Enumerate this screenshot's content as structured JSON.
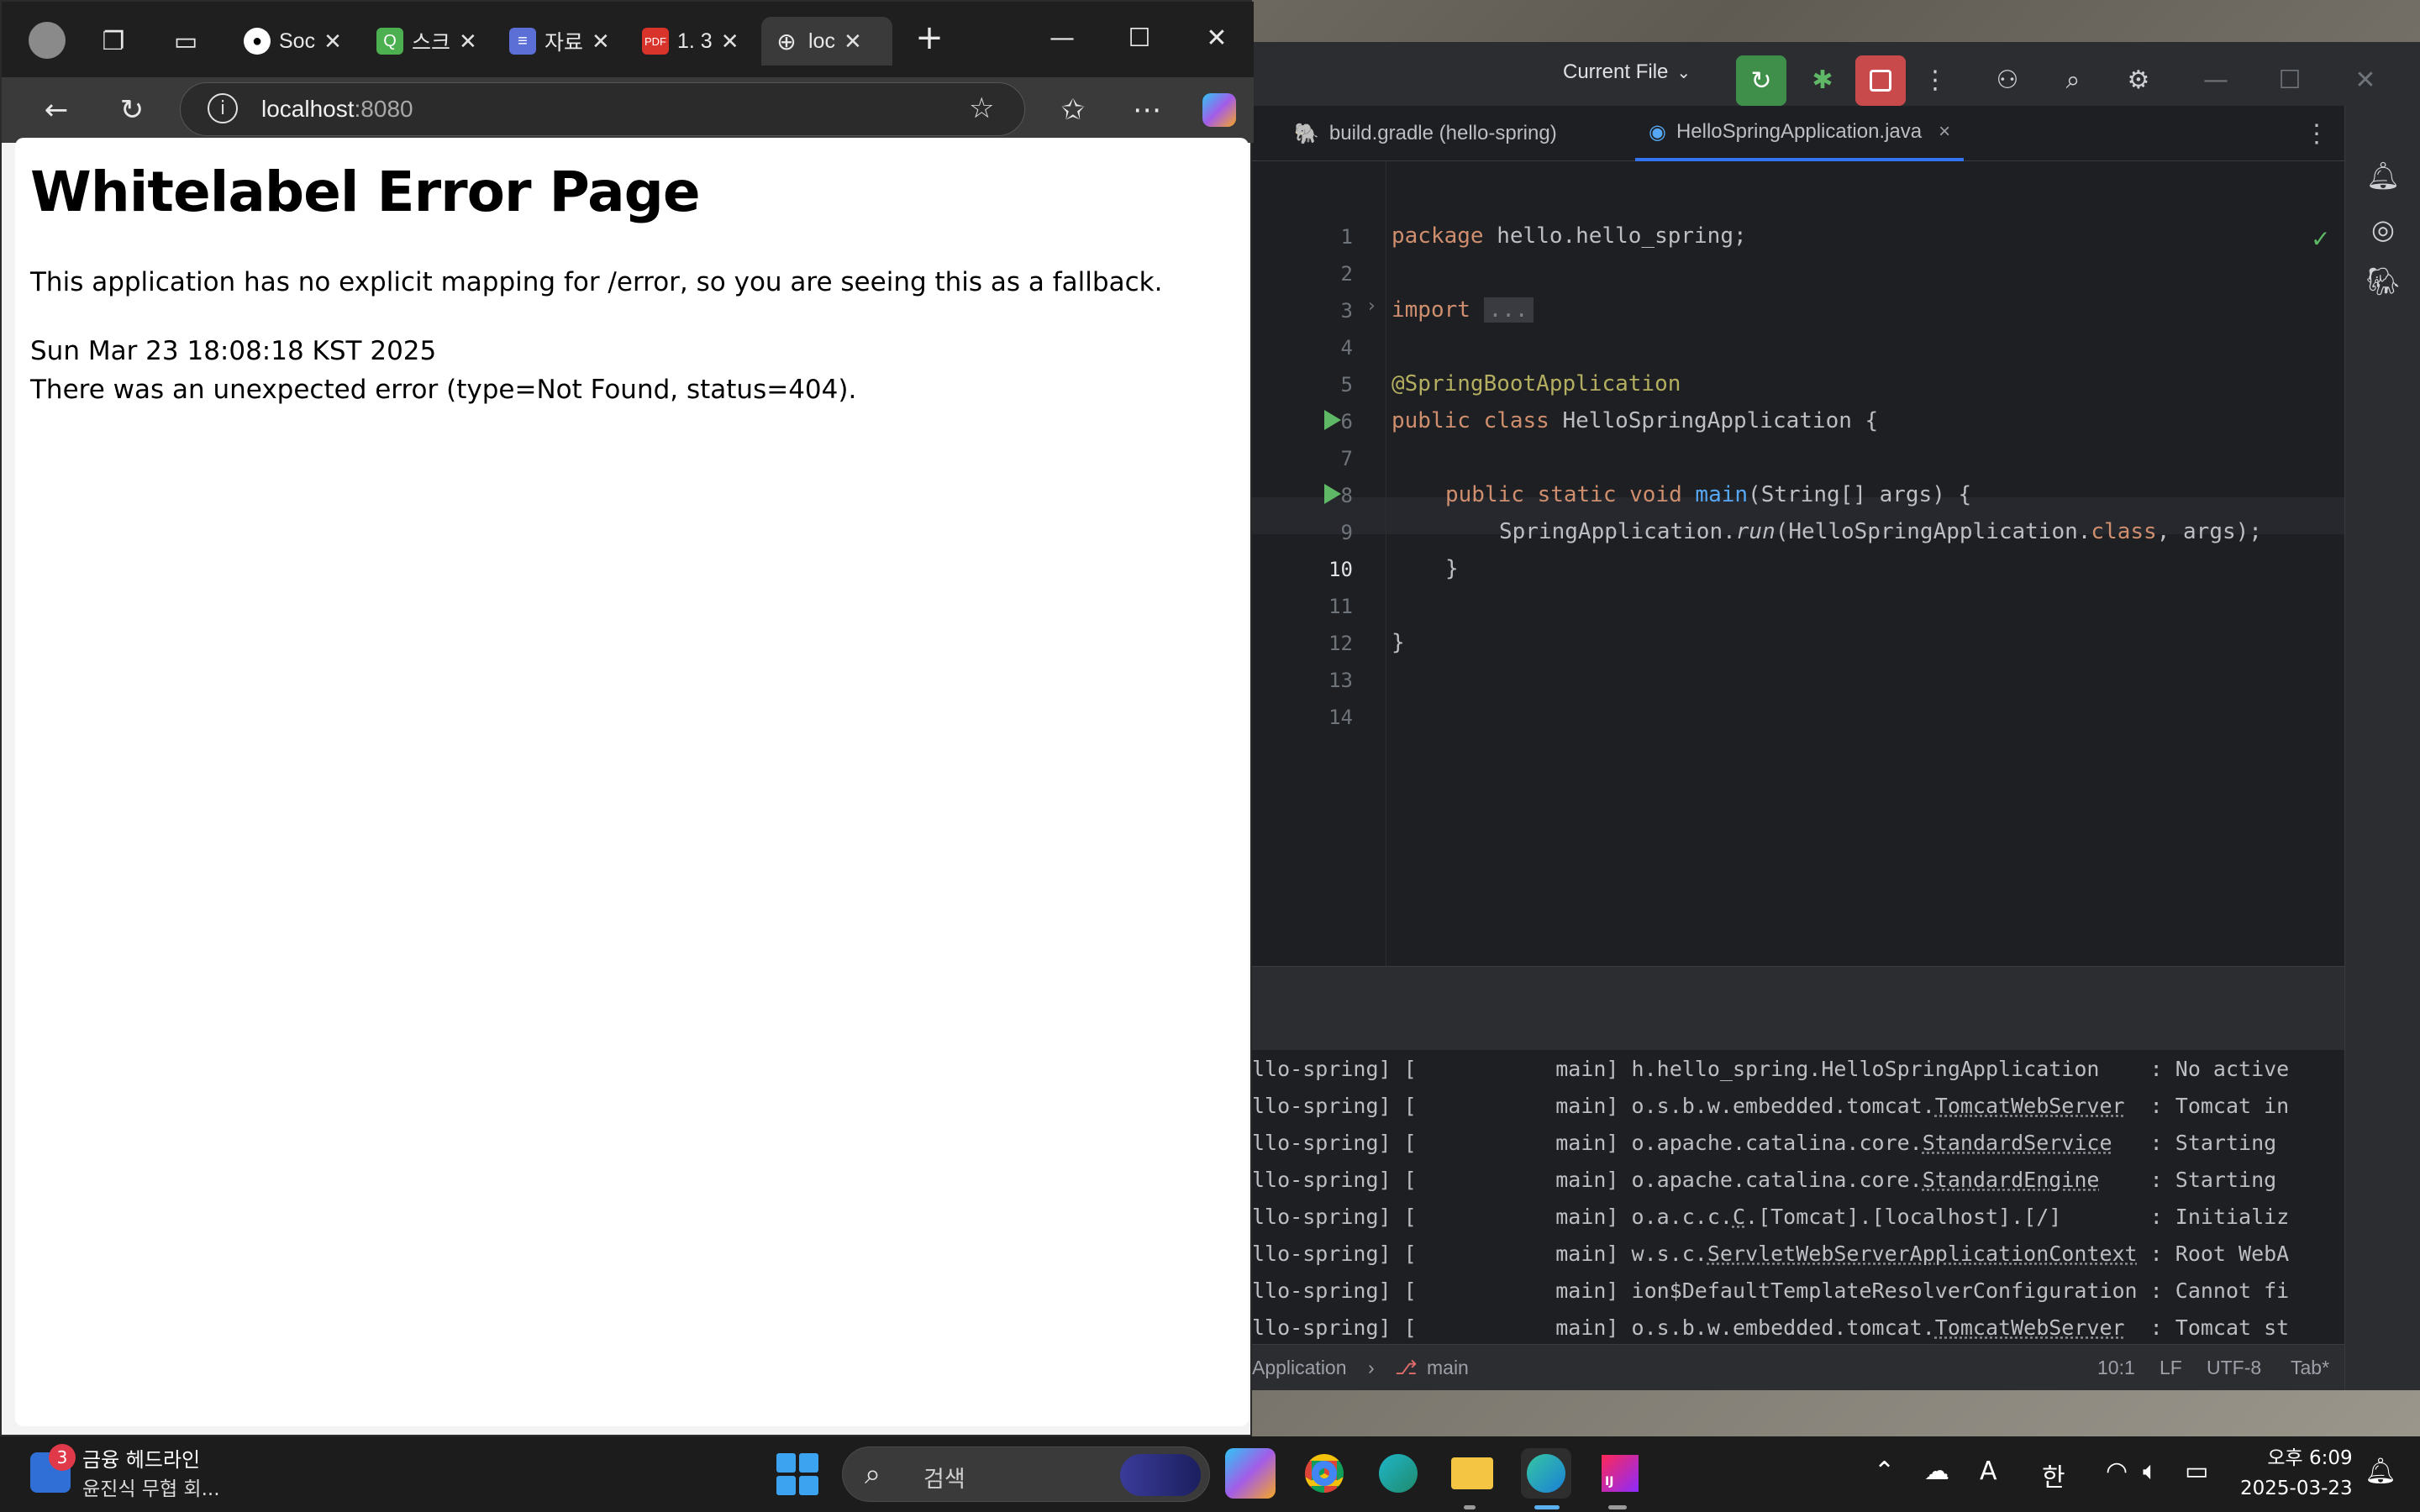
{
  "browser": {
    "tabs": [
      {
        "label": "Soc",
        "icon": "github-icon"
      },
      {
        "label": "스크",
        "icon": "green-app-icon"
      },
      {
        "label": "자료",
        "icon": "docs-icon"
      },
      {
        "label": "1. 3",
        "icon": "pdf-icon"
      },
      {
        "label": "loc",
        "icon": "globe-icon",
        "active": true
      }
    ],
    "address": {
      "host": "localhost",
      "port": ":8080"
    },
    "page": {
      "title": "Whitelabel Error Page",
      "line1": "This application has no explicit mapping for /error, so you are seeing this as a fallback.",
      "line2": "Sun Mar 23 18:08:18 KST 2025",
      "line3": "There was an unexpected error (type=Not Found, status=404)."
    }
  },
  "ide": {
    "run_config": "Current File",
    "tabs": [
      {
        "label": "build.gradle (hello-spring)"
      },
      {
        "label": "HelloSpringApplication.java",
        "active": true
      }
    ],
    "line_numbers": [
      "1",
      "2",
      "3",
      "4",
      "5",
      "6",
      "7",
      "8",
      "9",
      "10",
      "11",
      "12",
      "13",
      "14"
    ],
    "code": {
      "l1_kw": "package",
      "l1_rest": " hello.hello_spring;",
      "l3_kw": "import",
      "l3_fold": "...",
      "l6_ann": "@SpringBootApplication",
      "l7_kw": "public class",
      "l7_rest": " HelloSpringApplication {",
      "l9_kw": "public static void",
      "l9_fn": "main",
      "l9_rest": "(String[] args) {",
      "l10_a": "SpringApplication.",
      "l10_run": "run",
      "l10_b": "(HelloSpringApplication.",
      "l10_cls": "class",
      "l10_c": ", args);",
      "l11": "}",
      "l13": "}"
    },
    "console": [
      {
        "prefix": "llo-spring] [           main] ",
        "logger": "h.hello_spring.HelloSpringApplication   ",
        "msg": " : No active"
      },
      {
        "prefix": "llo-spring] [           main] ",
        "logger_a": "o.s.b.w.embedded.tomcat.",
        "logger_u": "TomcatWebServer",
        "pad": "  ",
        "msg": ": Tomcat in"
      },
      {
        "prefix": "llo-spring] [           main] ",
        "logger_a": "o.apache.catalina.core.",
        "logger_u": "StandardService",
        "pad": "   ",
        "msg": ": Starting"
      },
      {
        "prefix": "llo-spring] [           main] ",
        "logger_a": "o.apache.catalina.core.",
        "logger_u": "StandardEngine",
        "pad": "    ",
        "msg": ": Starting"
      },
      {
        "prefix": "llo-spring] [           main] ",
        "logger_a": "o.a.c.c.",
        "logger_u": "C",
        "logger_b": ".[Tomcat].[localhost].[/]",
        "pad": "       ",
        "msg": ": Initializ"
      },
      {
        "prefix": "llo-spring] [           main] ",
        "logger_a": "w.s.c.",
        "logger_u": "ServletWebServerApplicationContext",
        "pad": " ",
        "msg": ": Root WebA"
      },
      {
        "prefix": "llo-spring] [           main] ",
        "logger": "ion$DefaultTemplateResolverConfiguration",
        "msg": " : Cannot fi"
      },
      {
        "prefix": "llo-spring] [           main] ",
        "logger_a": "o.s.b.w.embedded.tomcat.",
        "logger_u": "TomcatWebServer",
        "pad": "  ",
        "msg": ": Tomcat st"
      }
    ],
    "status": {
      "crumb": "Application",
      "branch": "main",
      "position": "10:1",
      "line_sep": "LF",
      "encoding": "UTF-8",
      "indent": "Tab*"
    }
  },
  "taskbar": {
    "news_badge": "3",
    "news_title": "금융 헤드라인",
    "news_sub": "윤진식 무협 회...",
    "search_placeholder": "검색",
    "tray_ime": "한",
    "tray_font": "A",
    "time": "오후 6:09",
    "date": "2025-03-23"
  },
  "colors": {
    "accent": "#3574f0",
    "run_green": "#5fb865",
    "stop_red": "#d24a4a",
    "keyword": "#cf8e6d",
    "annotation": "#b3ae60",
    "function": "#56a8f5"
  }
}
